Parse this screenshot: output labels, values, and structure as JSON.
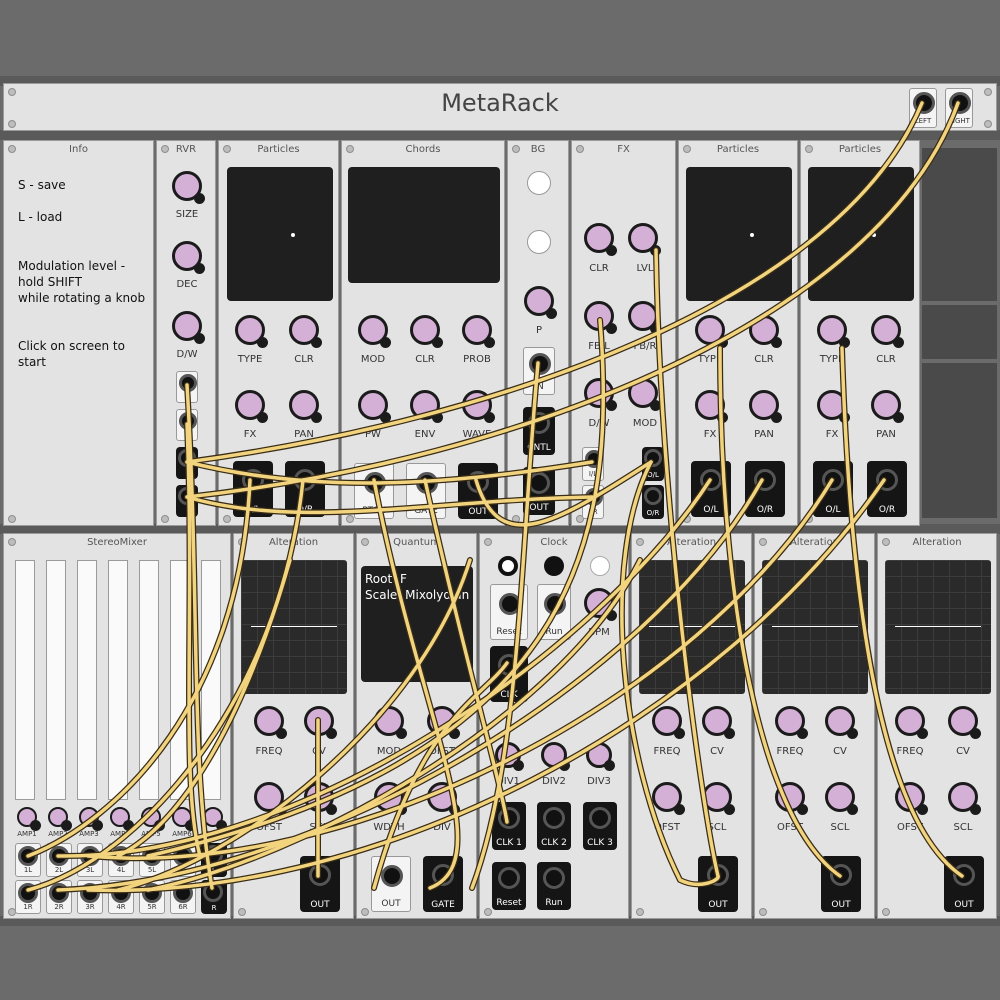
{
  "app": {
    "title": "MetaRack",
    "outputs": [
      "LEFT",
      "RIGHT"
    ]
  },
  "colors": {
    "knob": "#d4b0d6",
    "cable": "#f2d37e",
    "cable_edge": "#3a2d16",
    "panel": "#e3e3e3",
    "screen": "#1f1f1f"
  },
  "info": {
    "title": "Info",
    "lines": [
      "S - save",
      "L - load",
      "Modulation level -\nhold SHIFT\nwhile rotating a knob",
      "Click on screen to start"
    ]
  },
  "rvr": {
    "title": "RVR",
    "knobs": [
      "SIZE",
      "DEC",
      "D/W"
    ],
    "jacks": [
      "",
      "",
      "",
      ""
    ]
  },
  "particles1": {
    "title": "Particles",
    "knobs": [
      "TYPE",
      "CLR",
      "FX",
      "PAN"
    ],
    "outputs": [
      "O/L",
      "O/R"
    ]
  },
  "chords": {
    "title": "Chords",
    "knobs": [
      "MOD",
      "CLR",
      "PROB",
      "PW",
      "ENV",
      "WAVE"
    ],
    "inputs": [
      "PTCH",
      "GATE"
    ],
    "outputs": [
      "OUT"
    ]
  },
  "bg": {
    "title": "BG",
    "knob": "P",
    "jacks": [
      "IN",
      "CNTL",
      "OUT"
    ]
  },
  "fx": {
    "title": "FX",
    "knobs": [
      "CLR",
      "LVL",
      "FB/L",
      "FB/R",
      "D/W",
      "MOD"
    ],
    "jacks": [
      "I/L",
      "I/R",
      "O/L",
      "O/R"
    ]
  },
  "particles2": {
    "title": "Particles",
    "knobs": [
      "TYPE",
      "CLR",
      "FX",
      "PAN"
    ],
    "outputs": [
      "O/L",
      "O/R"
    ]
  },
  "particles3": {
    "title": "Particles",
    "knobs": [
      "TYPE",
      "CLR",
      "FX",
      "PAN"
    ],
    "outputs": [
      "O/L",
      "O/R"
    ]
  },
  "mixer": {
    "title": "StereoMixer",
    "amps": [
      "AMP1",
      "AMP2",
      "AMP3",
      "AMP4",
      "AMP5",
      "AMP6",
      "AMP"
    ],
    "left_inputs": [
      "1L",
      "2L",
      "3L",
      "4L",
      "5L",
      "6L",
      "L"
    ],
    "right_inputs": [
      "1R",
      "2R",
      "3R",
      "4R",
      "5R",
      "6R",
      "R"
    ]
  },
  "alteration1": {
    "title": "Alteration",
    "knobs": [
      "FREQ",
      "CV",
      "OFST",
      "SCL"
    ],
    "output": "OUT"
  },
  "quantum": {
    "title": "Quantum",
    "root": "Root: F",
    "scale": "Scale: Mixolydian",
    "knobs": [
      "MOD",
      "OFST",
      "WDTH",
      "DIV"
    ],
    "jacks": [
      "OUT",
      "GATE"
    ]
  },
  "clock": {
    "title": "Clock",
    "buttons": [
      "Reset",
      "Run"
    ],
    "bpm": "BPM",
    "clk": "CLK",
    "divs": [
      "DIV1",
      "DIV2",
      "DIV3"
    ],
    "clk_outs": [
      "CLK 1",
      "CLK 2",
      "CLK 3"
    ],
    "bottom_outs": [
      "Reset",
      "Run"
    ]
  },
  "alteration2": {
    "title": "Alteration",
    "knobs": [
      "FREQ",
      "CV",
      "OFST",
      "SCL"
    ],
    "output": "OUT"
  },
  "alteration3": {
    "title": "Alteration",
    "knobs": [
      "FREQ",
      "CV",
      "OFST",
      "SCL"
    ],
    "output": "OUT"
  },
  "alteration4": {
    "title": "Alteration",
    "knobs": [
      "FREQ",
      "CV",
      "OFST",
      "SCL"
    ],
    "output": "OUT"
  }
}
